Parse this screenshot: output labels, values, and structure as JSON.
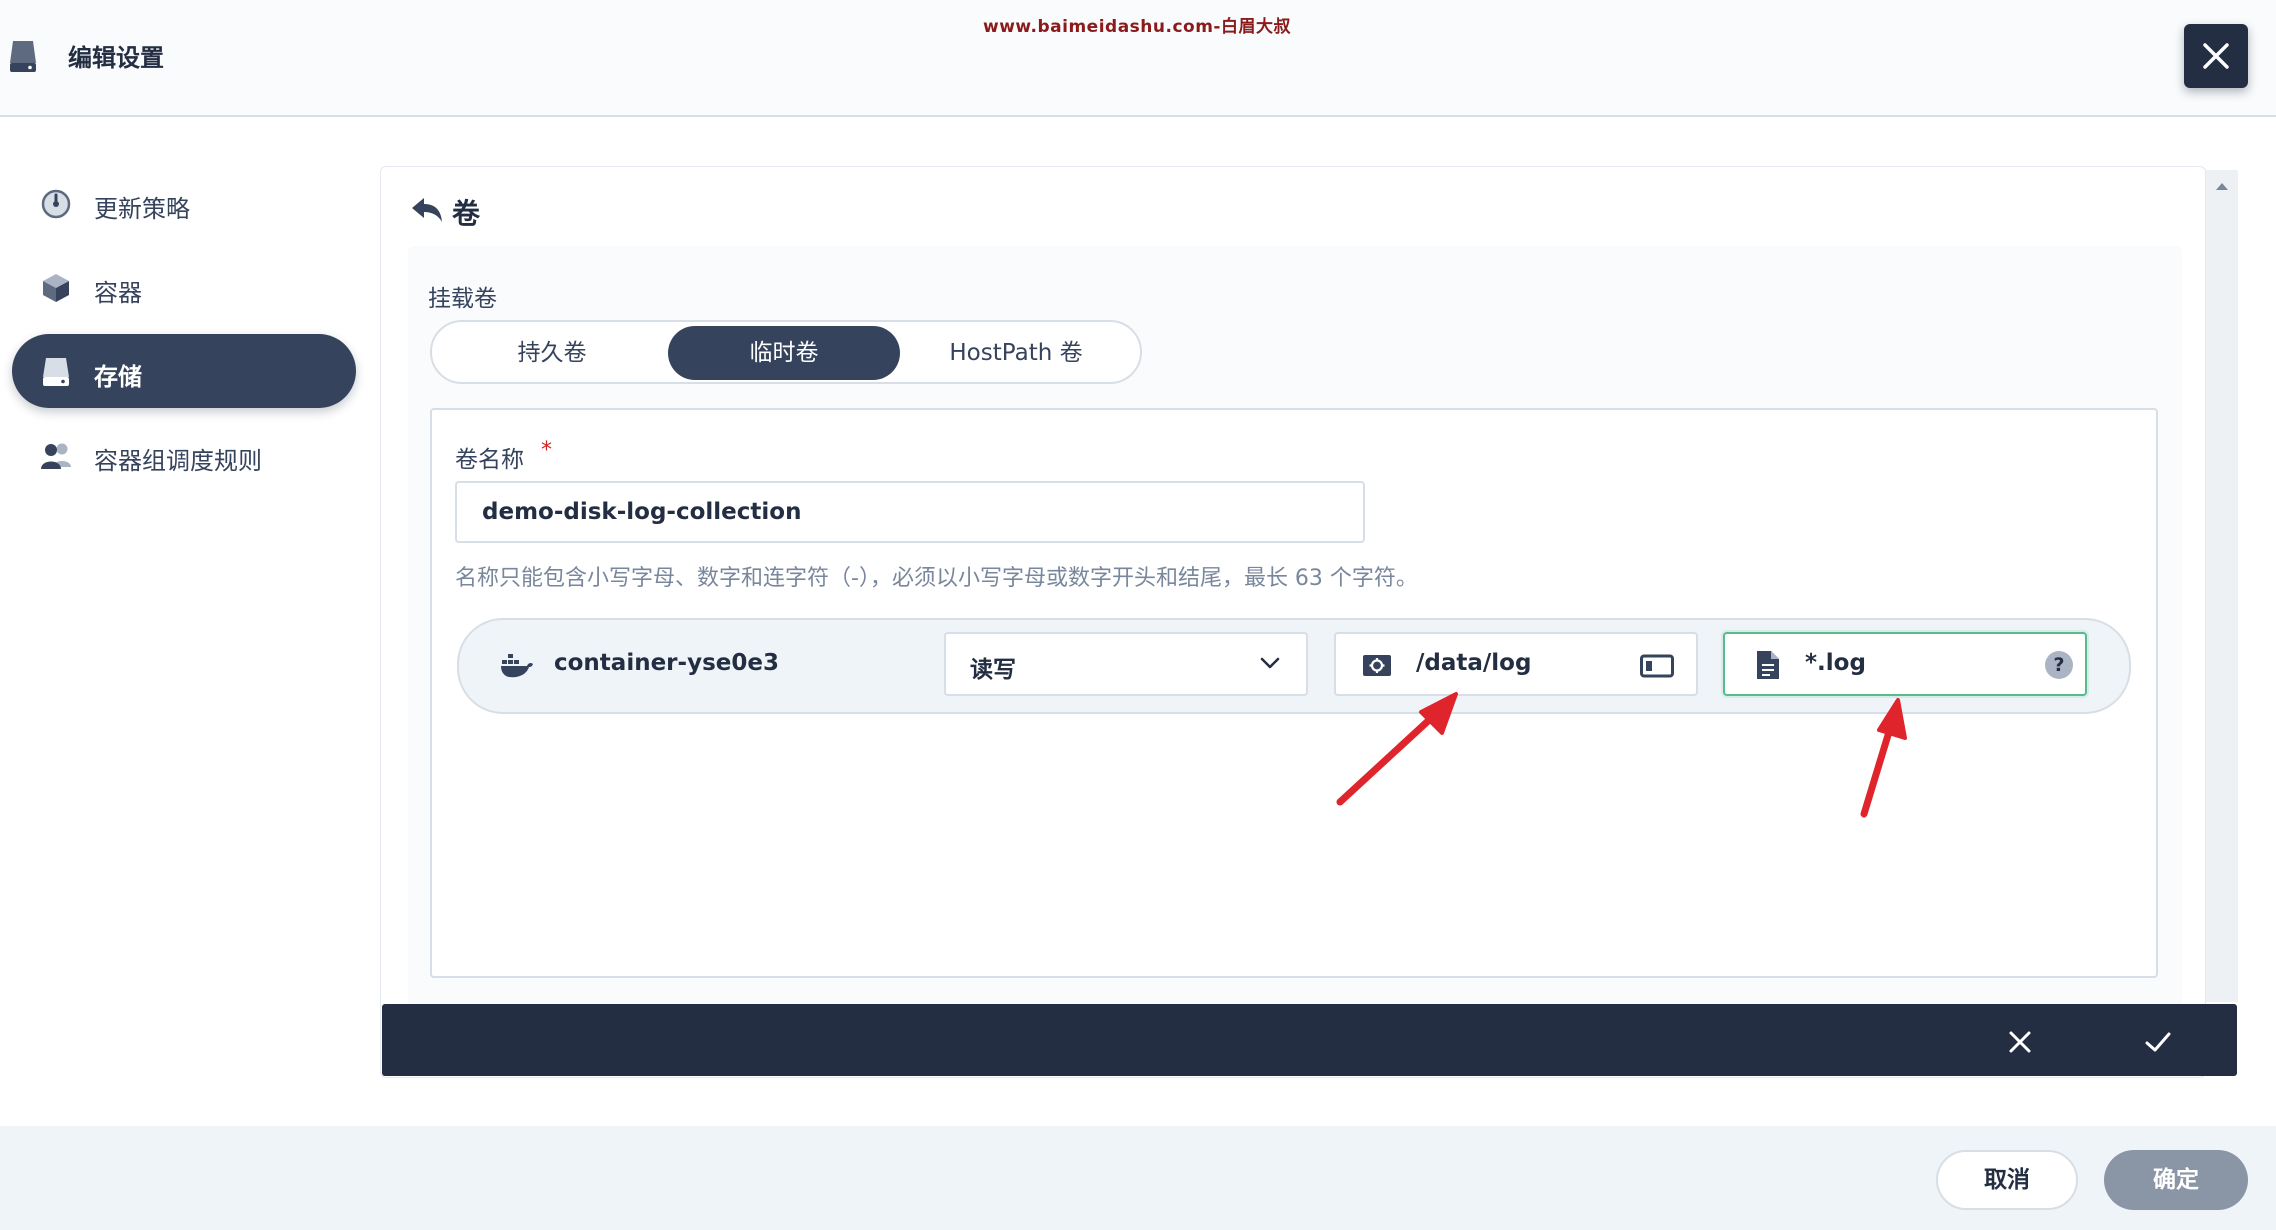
{
  "watermark": "www.baimeidashu.com-白眉大叔",
  "header": {
    "title": "编辑设置"
  },
  "sidebar": {
    "items": [
      {
        "label": "更新策略",
        "icon": "gauge-icon",
        "active": false
      },
      {
        "label": "容器",
        "icon": "cube-icon",
        "active": false
      },
      {
        "label": "存储",
        "icon": "storage-icon",
        "active": true
      },
      {
        "label": "容器组调度规则",
        "icon": "users-icon",
        "active": false
      }
    ]
  },
  "volume_panel": {
    "title": "卷",
    "mount_label": "挂载卷",
    "tabs": [
      {
        "label": "持久卷",
        "active": false
      },
      {
        "label": "临时卷",
        "active": true
      },
      {
        "label": "HostPath 卷",
        "active": false
      }
    ],
    "name_field": {
      "label": "卷名称",
      "required_mark": "*",
      "value": "demo-disk-log-collection",
      "hint": "名称只能包含小写字母、数字和连字符（-），必须以小写字母或数字开头和结尾，最长 63 个字符。"
    },
    "container_mount": {
      "container_name": "container-yse0e3",
      "access_mode": "读写",
      "mount_path": "/data/log",
      "log_path": "*.log",
      "help_symbol": "?"
    }
  },
  "footer": {
    "cancel_label": "取消",
    "confirm_label": "确定"
  },
  "colors": {
    "primary_dark": "#242e42",
    "sidebar_active": "#36435c",
    "focus_green": "#55bc8a",
    "annotation_red": "#e0242b",
    "confirm_disabled": "#8a95a5"
  }
}
